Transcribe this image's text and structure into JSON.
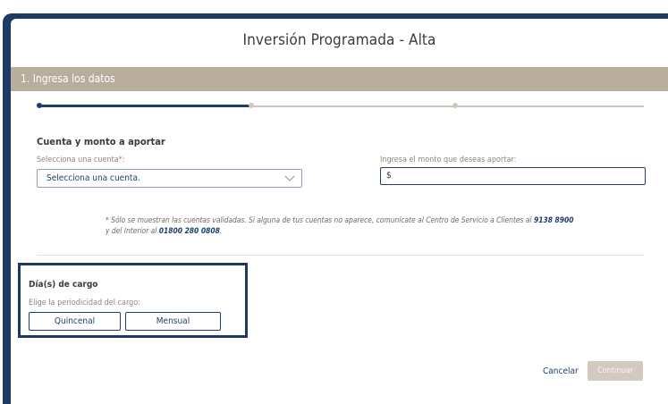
{
  "modal": {
    "title": "Inversión Programada - Alta"
  },
  "section": {
    "title": "1. Ingresa los datos"
  },
  "stepper": {
    "current_step": 1,
    "total_steps": 3,
    "progress_fraction": 0.33
  },
  "account_section": {
    "heading": "Cuenta y monto a aportar",
    "account_label": "Selecciona una cuenta*:",
    "account_value": "Selecciona una cuenta.",
    "amount_label": "Ingresa el monto que deseas aportar:",
    "amount_prefix": "$",
    "amount_value": ""
  },
  "note": {
    "part1": "* Sólo se muestran las cuentas validadas. Si alguna de tus cuentas no aparece, comunícate al Centro de Servicio a Clientes al ",
    "phone1": "9138 8900",
    "part2": "y del Interior al ",
    "phone2": "01800 280 0808",
    "part3": "."
  },
  "charge_days": {
    "heading": "Día(s) de cargo",
    "label": "Elige la periodicidad del cargo:",
    "options": [
      "Quincenal",
      "Mensual"
    ]
  },
  "actions": {
    "cancel_label": "Cancelar",
    "continue_label": "Continuar"
  },
  "colors": {
    "navy": "#1d3a63",
    "section_bar": "#b9ae9d",
    "disabled_button": "#d2cabf"
  }
}
